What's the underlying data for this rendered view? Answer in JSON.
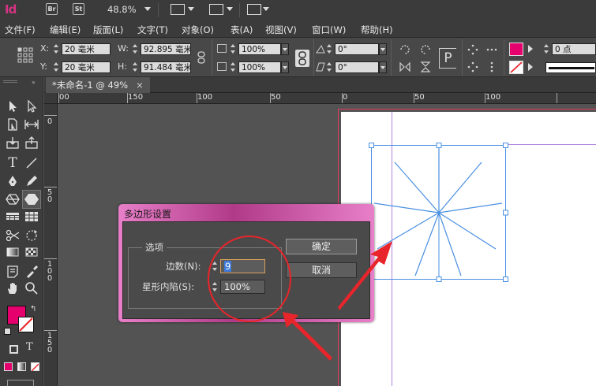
{
  "app": {
    "logo": "Id",
    "bridge_label": "Br",
    "stock_label": "St",
    "zoom": "48.8%"
  },
  "menu": [
    "文件(F)",
    "编辑(E)",
    "版面(L)",
    "文字(T)",
    "对象(O)",
    "表(A)",
    "视图(V)",
    "窗口(W)",
    "帮助(H)"
  ],
  "control": {
    "x_label": "X:",
    "x_value": "20 毫米",
    "y_label": "Y:",
    "y_value": "20 毫米",
    "w_label": "W:",
    "w_value": "92.895 毫米",
    "h_label": "H:",
    "h_value": "91.484 毫米",
    "scale_x": "100%",
    "scale_y": "100%",
    "rotate": "0°",
    "shear": "0°",
    "stroke_weight": "0 点",
    "fill_color": "#e6006e"
  },
  "document_tab": {
    "title": "*未命名-1 @ 49%",
    "close": "×"
  },
  "ruler": {
    "h_labels": [
      "00",
      "150",
      "100",
      "50",
      "0",
      "50",
      "100"
    ],
    "v_labels": [
      "0",
      "5\n0",
      "1\n0\n0",
      "1\n5\n0"
    ]
  },
  "dialog": {
    "title": "多边形设置",
    "group_label": "选项",
    "sides_label": "边数(N):",
    "sides_value": "9",
    "inset_label": "星形内陷(S):",
    "inset_value": "100%",
    "ok_label": "确定",
    "cancel_label": "取消"
  },
  "colors": {
    "annotation": "#e8252a",
    "selection": "#4a90e2",
    "accent": "#e6006e"
  }
}
